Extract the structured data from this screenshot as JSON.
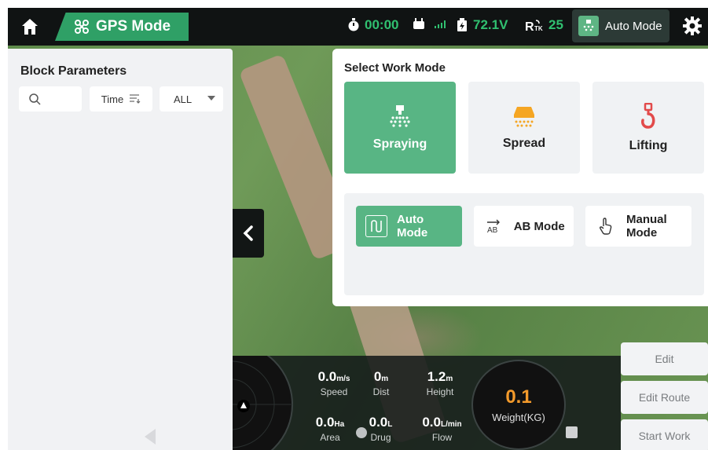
{
  "topbar": {
    "mode_label": "GPS Mode",
    "timer": "00:00",
    "voltage": "72.1V",
    "rtk_count": "25",
    "work_mode_label": "Auto Mode"
  },
  "block_panel": {
    "title": "Block Parameters",
    "sort_label": "Time",
    "filter_value": "ALL"
  },
  "work_mode_panel": {
    "title": "Select Work Mode",
    "modes": [
      {
        "label": "Spraying",
        "icon": "spray-nozzle-icon",
        "selected": true
      },
      {
        "label": "Spread",
        "icon": "spreader-icon",
        "selected": false
      },
      {
        "label": "Lifting",
        "icon": "hook-icon",
        "selected": false
      }
    ],
    "sub_modes": [
      {
        "label": "Auto Mode",
        "icon": "route-icon",
        "selected": true
      },
      {
        "label": "AB Mode",
        "icon": "ab-line-icon",
        "selected": false
      },
      {
        "label": "Manual Mode",
        "icon": "hand-pointer-icon",
        "selected": false
      }
    ]
  },
  "telemetry": {
    "speed": {
      "value": "0.0",
      "unit": "m/s",
      "label": "Speed"
    },
    "dist": {
      "value": "0",
      "unit": "m",
      "label": "Dist"
    },
    "height": {
      "value": "1.2",
      "unit": "m",
      "label": "Height"
    },
    "area": {
      "value": "0.0",
      "unit": "Ha",
      "label": "Area"
    },
    "drug": {
      "value": "0.0",
      "unit": "L",
      "label": "Drug"
    },
    "flow": {
      "value": "0.0",
      "unit": "L/min",
      "label": "Flow"
    },
    "weight": {
      "value": "0.1",
      "label": "Weight(KG)"
    }
  },
  "actions": {
    "edit": "Edit",
    "edit_route": "Edit Route",
    "start_work": "Start Work"
  },
  "colors": {
    "accent_green": "#58b584",
    "status_green": "#30c070",
    "weight_orange": "#f39a2b",
    "spread_orange": "#f5a623",
    "lifting_red": "#e24a4a"
  }
}
